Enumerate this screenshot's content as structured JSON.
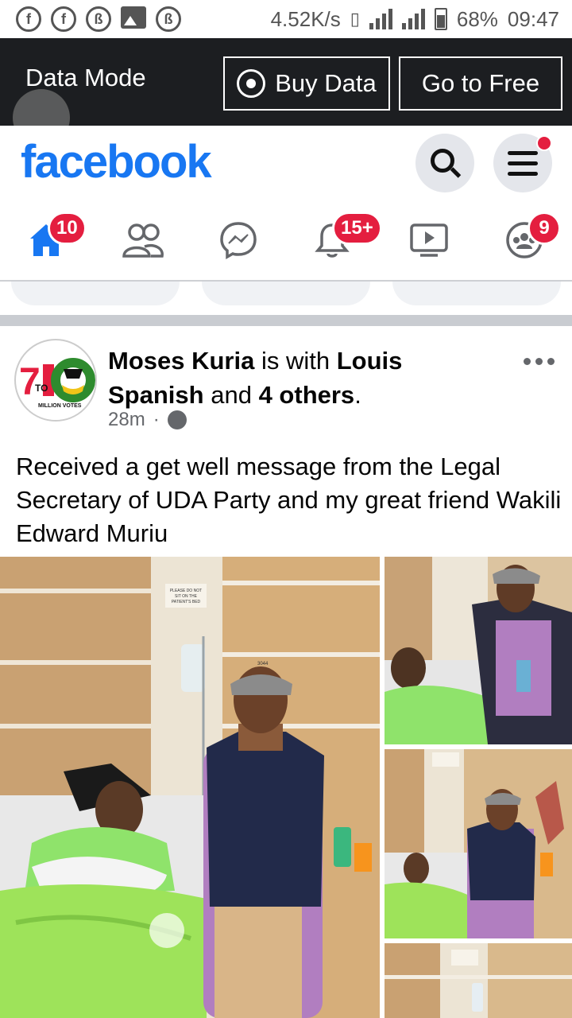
{
  "status_bar": {
    "left_icons": [
      "facebook-notification-icon",
      "facebook-notification-icon",
      "b-app-icon",
      "gallery-icon",
      "b-app-icon"
    ],
    "speed": "4.52K/s",
    "battery": "68%",
    "time": "09:47"
  },
  "data_mode": {
    "label": "Data Mode",
    "buy_label": "Buy Data",
    "free_label": "Go to Free"
  },
  "header": {
    "logo": "facebook",
    "brand_color": "#1877f2"
  },
  "nav": {
    "home_badge": "10",
    "notifications_badge": "15+",
    "groups_badge": "9"
  },
  "post": {
    "author": "Moses Kuria",
    "with_text": "is with",
    "tagged": "Louis Spanish",
    "and_text": "and",
    "others": "4 others",
    "period": ".",
    "time": "28m",
    "dot": "·",
    "text": "Received a get well message from the Legal Secretary of UDA Party and my great friend Wakili Edward Muriu",
    "avatar_text": {
      "big_number": "710",
      "to": "TO",
      "caption": "MILLION VOTES"
    },
    "photo_sign": [
      "PLEASE DO NOT",
      "SIT ON THE",
      "PATIENT'S BED"
    ],
    "room_number": "3044"
  }
}
